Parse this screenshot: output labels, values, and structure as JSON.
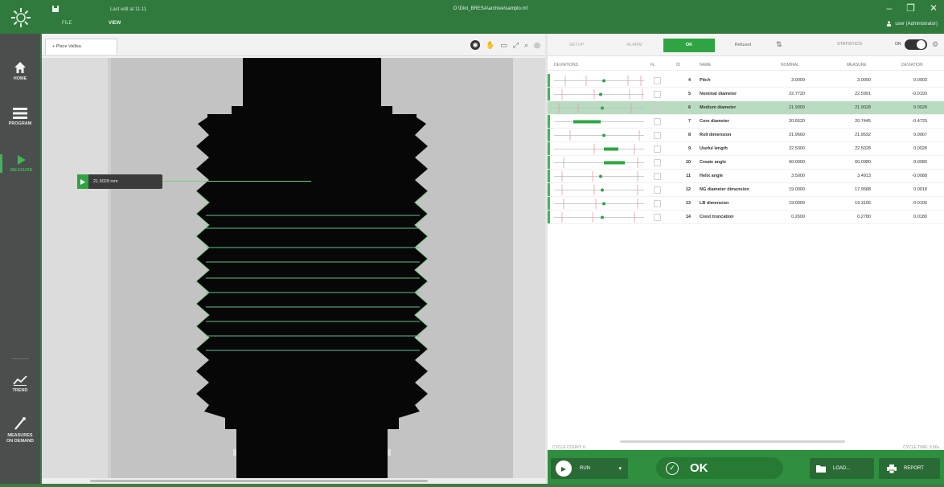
{
  "app": {
    "last_edit": "Last edit at 11:11",
    "file_path": "D:\\Diot_BRESA\\archive\\samplo.mf",
    "user": "user (Administrator)",
    "menu": {
      "file": "FILE",
      "view": "VIEW"
    },
    "window_controls": {
      "minimize": "–",
      "restore": "❐",
      "close": "✕"
    }
  },
  "sidebar": {
    "items": [
      {
        "label": "HOME",
        "icon": "home-icon"
      },
      {
        "label": "PROGRAM",
        "icon": "list-icon"
      },
      {
        "label": "MEASURE",
        "icon": "play-icon"
      },
      {
        "label": "TREND",
        "icon": "trend-icon"
      },
      {
        "label": "MEASURES ON DEMAND",
        "icon": "wand-icon"
      }
    ],
    "active_color": "#46b25a"
  },
  "viewer": {
    "tab_label": "+ Place Vallisa",
    "tools": [
      "select-icon",
      "hand-icon",
      "fit-width-icon",
      "fullscreen-icon",
      "zoom-icon",
      "eye-icon"
    ],
    "measure_tag": "21.9028 mm"
  },
  "results": {
    "status_pills": {
      "setup": "SETUP",
      "alarm": "ALARM",
      "ok": "OK",
      "refused": "Refused"
    },
    "statistics_label": "STATISTICS",
    "toggle_label": "ON",
    "columns": {
      "spark": "DEVIATIONS",
      "flag": "FL",
      "id": "ID",
      "name": "NAME",
      "nominal": "NOMINAL",
      "measure": "MEASURE",
      "deviation": "DEVIATION"
    },
    "rows": [
      {
        "id": "4",
        "name": "Pitch",
        "nominal": "3.0000",
        "measure": "3.0000",
        "deviation": "0.0003",
        "selected": false
      },
      {
        "id": "5",
        "name": "Nominal diameter",
        "nominal": "22.7720",
        "measure": "22.5991",
        "deviation": "-0.0193",
        "selected": false
      },
      {
        "id": "6",
        "name": "Medium diameter",
        "nominal": "21.9000",
        "measure": "21.9028",
        "deviation": "0.0028",
        "selected": true
      },
      {
        "id": "7",
        "name": "Core diameter",
        "nominal": "20.6620",
        "measure": "20.7445",
        "deviation": "-0.4725",
        "selected": false
      },
      {
        "id": "8",
        "name": "Roll dimension",
        "nominal": "21.9660",
        "measure": "21.9592",
        "deviation": "0.0067",
        "selected": false
      },
      {
        "id": "9",
        "name": "Useful length",
        "nominal": "22.5000",
        "measure": "22.5028",
        "deviation": "0.0028",
        "selected": false
      },
      {
        "id": "10",
        "name": "Create angle",
        "nominal": "60.0000",
        "measure": "60.0980",
        "deviation": "0.0980",
        "selected": false
      },
      {
        "id": "11",
        "name": "Helix angle",
        "nominal": "3.5000",
        "measure": "3.4913",
        "deviation": "-0.0088",
        "selected": false
      },
      {
        "id": "12",
        "name": "NG diameter dimension",
        "nominal": "19.0000",
        "measure": "17.9588",
        "deviation": "0.0018",
        "selected": false
      },
      {
        "id": "13",
        "name": "LB dimension",
        "nominal": "19.0000",
        "measure": "19.3166",
        "deviation": "-0.0106",
        "selected": false
      },
      {
        "id": "14",
        "name": "Crest truncation",
        "nominal": "0.2600",
        "measure": "0.2780",
        "deviation": "0.0180",
        "selected": false
      }
    ],
    "footer_left": "CYCLE COUNT: 6",
    "footer_right": "CYCLE TIME: 0.56s"
  },
  "actions": {
    "run": "RUN",
    "ok": "OK",
    "load": "LOAD...",
    "report": "REPORT"
  },
  "colors": {
    "brand": "#2f7a3c",
    "ok_green": "#2fa443",
    "selected_row": "#b9dcc1"
  }
}
